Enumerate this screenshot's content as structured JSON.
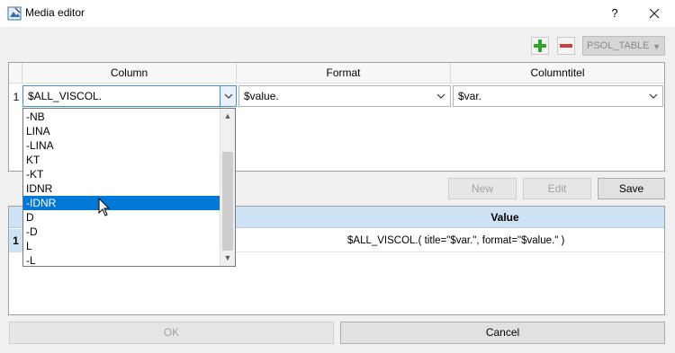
{
  "window": {
    "title": "Media editor",
    "help_label": "?",
    "icons": {
      "app": "media-editor-icon",
      "close": "close-icon"
    }
  },
  "toolbar": {
    "add_icon": "plus-icon",
    "remove_icon": "minus-icon",
    "table_select_value": "PSOL_TABLE",
    "colors": {
      "add": "#2fa52a",
      "remove": "#d43a3a"
    }
  },
  "upper_table": {
    "headers": [
      "Column",
      "Format",
      "Columntitel"
    ],
    "rows": [
      {
        "num": "1",
        "column": "$ALL_VISCOL.",
        "format": "$value.",
        "columntitel": "$var."
      }
    ]
  },
  "dropdown": {
    "items": [
      "-NB",
      "LINA",
      "-LINA",
      "KT",
      "-KT",
      "IDNR",
      "-IDNR",
      "D",
      "-D",
      "L",
      "-L"
    ],
    "selected_index": 6,
    "selection_color": "#0078d7"
  },
  "buttons": {
    "new": "New",
    "edit": "Edit",
    "save": "Save",
    "ok": "OK",
    "cancel": "Cancel"
  },
  "lower_table": {
    "header_value": "Value",
    "rows": [
      {
        "num": "1",
        "value": "$ALL_VISCOL.( title=\"$var.\", format=\"$value.\" )"
      }
    ],
    "header_color": "#cfe2f5"
  }
}
